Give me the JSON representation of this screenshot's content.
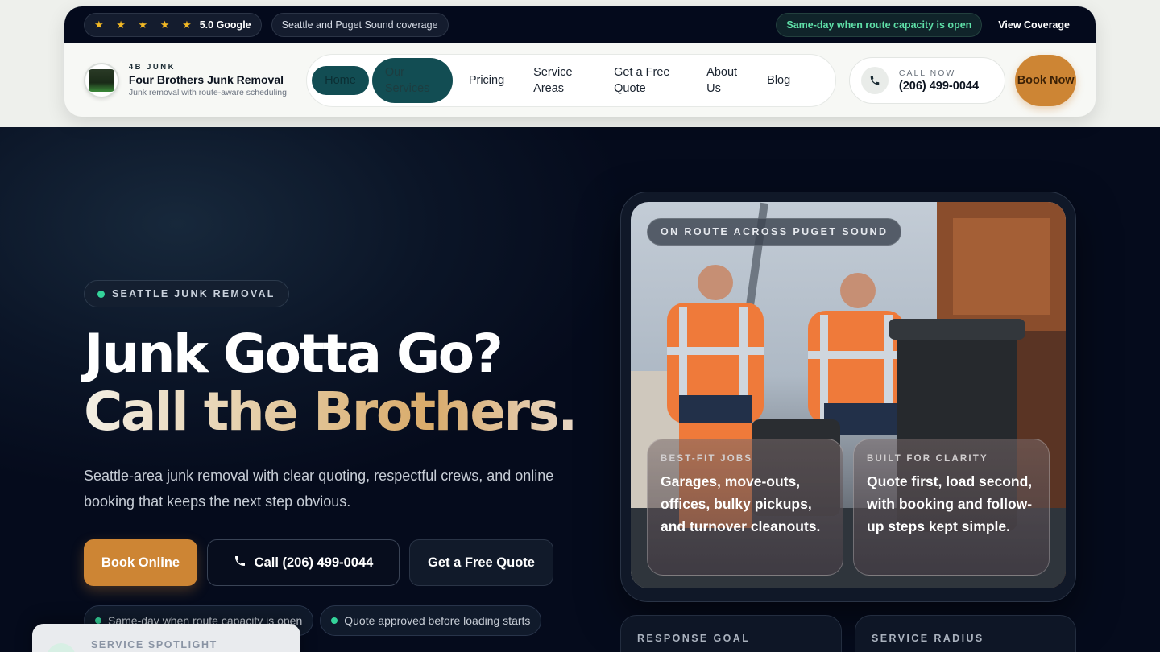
{
  "topbar": {
    "rating_stars": "★ ★ ★ ★ ★",
    "rating_text": "5.0 Google",
    "coverage_text": "Seattle and Puget Sound coverage",
    "availability_text": "Same-day when route capacity is open",
    "view_coverage_link": "View Coverage"
  },
  "brand": {
    "kicker": "4B JUNK",
    "name": "Four Brothers Junk Removal",
    "tagline": "Junk removal with route-aware scheduling",
    "logo_text": "FOUR BROTHERS"
  },
  "nav": {
    "items": [
      {
        "label": "Home"
      },
      {
        "label": "Our Services"
      },
      {
        "label": "Pricing"
      },
      {
        "label": "Service Areas"
      },
      {
        "label": "Get a Free Quote"
      },
      {
        "label": "About Us"
      },
      {
        "label": "Blog"
      }
    ],
    "call_label": "CALL NOW",
    "call_number": "(206) 499-0044",
    "book_now": "Book Now"
  },
  "hero": {
    "eyebrow": "SEATTLE JUNK REMOVAL",
    "headline_line1": "Junk Gotta Go?",
    "headline_line2": "Call the Brothers.",
    "subcopy": "Seattle-area junk removal with clear quoting, respectful crews, and online booking that keeps the next step obvious.",
    "cta_book": "Book Online",
    "cta_call": "Call (206) 499-0044",
    "cta_quote": "Get a Free Quote",
    "chips": [
      "Same-day when route capacity is open",
      "Quote approved before loading starts"
    ]
  },
  "spotlight": {
    "label": "SERVICE SPOTLIGHT"
  },
  "media": {
    "route_tag": "ON ROUTE ACROSS PUGET SOUND",
    "card1_label": "BEST-FIT JOBS",
    "card1_text": "Garages, move-outs, offices, bulky pickups, and turnover cleanouts.",
    "card2_label": "BUILT FOR CLARITY",
    "card2_text": "Quote first, load second, with booking and follow-up steps kept simple."
  },
  "stats": {
    "response_label": "RESPONSE GOAL",
    "radius_label": "SERVICE RADIUS"
  },
  "colors": {
    "accent": "#cd8534",
    "teal": "#124d53",
    "navy": "#050b1c",
    "success": "#34d39a"
  }
}
